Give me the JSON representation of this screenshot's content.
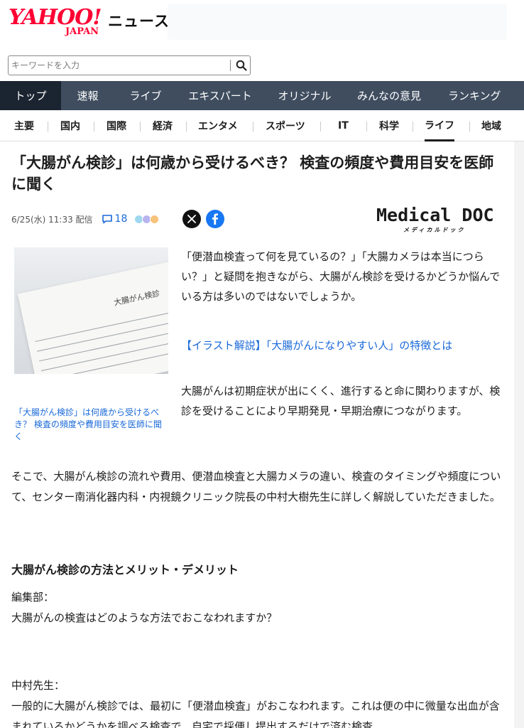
{
  "header": {
    "logo_text": "YAHOO!",
    "logo_sub": "JAPAN",
    "section_name": "ニュース"
  },
  "search": {
    "placeholder": "キーワードを入力"
  },
  "global_nav": [
    {
      "label": "トップ",
      "active": true
    },
    {
      "label": "速報",
      "active": false
    },
    {
      "label": "ライブ",
      "active": false
    },
    {
      "label": "エキスパート",
      "active": false
    },
    {
      "label": "オリジナル",
      "active": false
    },
    {
      "label": "みんなの意見",
      "active": false
    },
    {
      "label": "ランキング",
      "active": false
    }
  ],
  "sub_nav": [
    {
      "label": "主要",
      "active": false
    },
    {
      "label": "国内",
      "active": false
    },
    {
      "label": "国際",
      "active": false
    },
    {
      "label": "経済",
      "active": false
    },
    {
      "label": "エンタメ",
      "active": false
    },
    {
      "label": "スポーツ",
      "active": false
    },
    {
      "label": "IT",
      "active": false
    },
    {
      "label": "科学",
      "active": false
    },
    {
      "label": "ライフ",
      "active": true
    },
    {
      "label": "地域",
      "active": false
    }
  ],
  "article": {
    "title": "「大腸がん検診」は何歳から受けるべき？ 検査の頻度や費用目安を医師に聞く",
    "date": "6/25(水) 11:33 配信",
    "comment_count": "18",
    "provider_name": "Medical DOC",
    "provider_kana": "メディカルドック",
    "figure_caption": "「大腸がん検診」は何歳から受けるべき？ 検査の頻度や費用目安を医師に聞く",
    "figure_photo_text": "大腸がん検診",
    "lead_1": "「便潜血検査って何を見ているの？」「大腸カメラは本当につらい？」と疑問を抱きながら、大腸がん検診を受けるかどうか悩んでいる方は多いのではないでしょうか。",
    "related_link": "【イラスト解説】「大腸がんになりやすい人」の特徴とは",
    "lead_2": "大腸がんは初期症状が出にくく、進行すると命に関わりますが、検診を受けることにより早期発見・早期治療につながります。",
    "paragraph_1": "そこで、大腸がん検診の流れや費用、便潜血検査と大腸カメラの違い、検査のタイミングや頻度について、センター南消化器内科・内視鏡クリニック院長の中村大樹先生に詳しく解説していただきました。",
    "heading_1": "大腸がん検診の方法とメリット・デメリット",
    "speaker_1": "編集部：",
    "question_1": "大腸がんの検査はどのような方法でおこなわれますか？",
    "speaker_2": "中村先生：",
    "answer_1": "一般的に大腸がん検診では、最初に「便潜血検査」がおこなわれます。これは便の中に微量な出血が含まれているかどうかを調べる検査で、自宅で採便し提出するだけで済む検査"
  },
  "colors": {
    "brand_red": "#ff0033",
    "nav_bg": "#3f4d5f",
    "nav_active_bg": "#1b2431",
    "link_blue": "#1969d8"
  }
}
